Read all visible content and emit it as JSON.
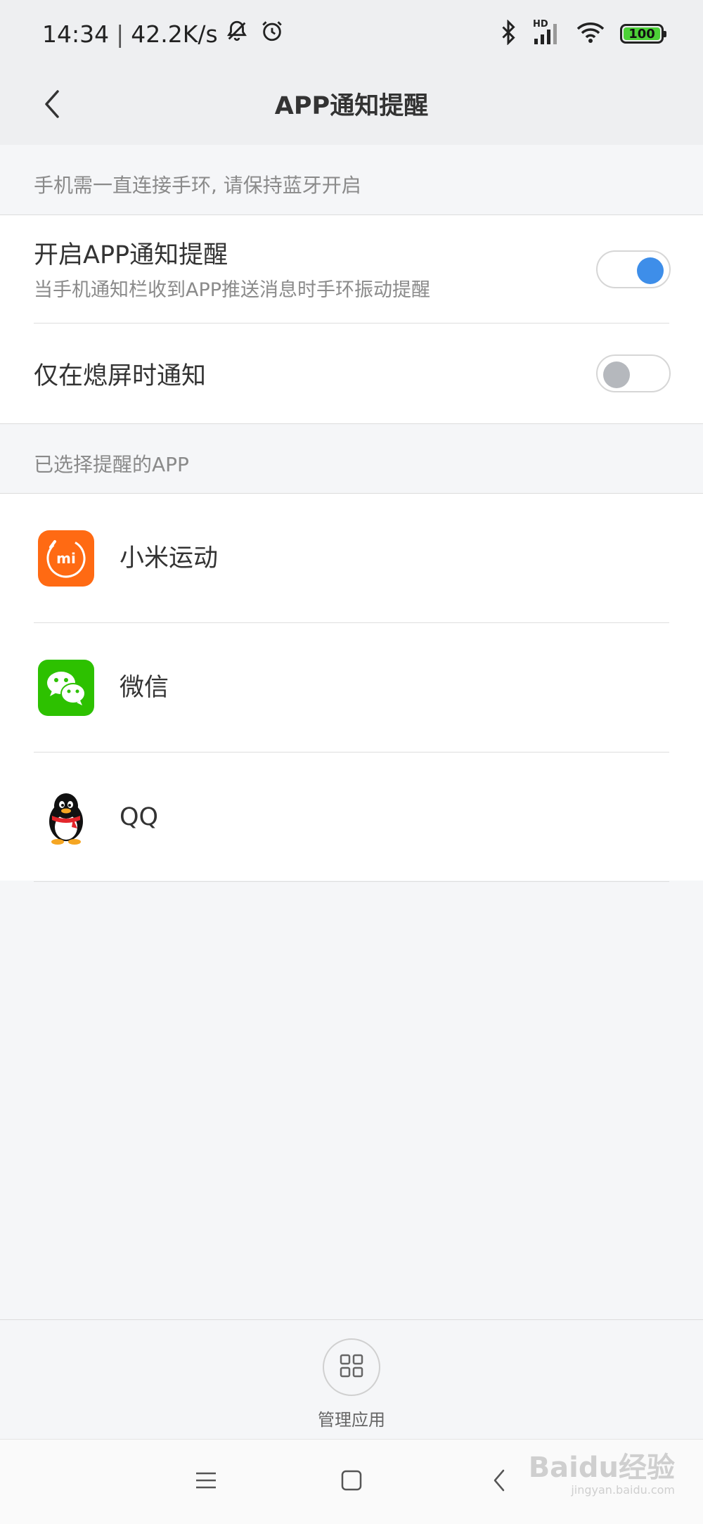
{
  "status_bar": {
    "time": "14:34",
    "separator": "|",
    "network_speed": "42.2K/s",
    "network_badge": "HD",
    "battery_level": "100",
    "icons": [
      "mute-bell-icon",
      "alarm-icon",
      "bluetooth-icon",
      "signal-icon",
      "wifi-icon",
      "battery-icon"
    ]
  },
  "header": {
    "title": "APP通知提醒",
    "back_icon": "chevron-left-icon"
  },
  "bluetooth_hint": "手机需一直连接手环, 请保持蓝牙开启",
  "settings": [
    {
      "title": "开启APP通知提醒",
      "subtitle": "当手机通知栏收到APP推送消息时手环振动提醒",
      "enabled": true
    },
    {
      "title": "仅在熄屏时通知",
      "enabled": false
    }
  ],
  "apps_section": {
    "header": "已选择提醒的APP",
    "apps": [
      {
        "name": "小米运动",
        "icon": "mi-fit-icon",
        "icon_text": "mi",
        "color": "#ff6a13"
      },
      {
        "name": "微信",
        "icon": "wechat-icon",
        "color": "#2dc100"
      },
      {
        "name": "QQ",
        "icon": "qq-penguin-icon"
      }
    ]
  },
  "manage_apps": {
    "label": "管理应用",
    "icon": "grid-icon"
  },
  "system_nav": {
    "icons": [
      "menu-icon",
      "home-icon",
      "back-icon"
    ]
  },
  "watermark": {
    "text": "Baidu经验",
    "sub": "jingyan.baidu.com"
  },
  "colors": {
    "toggle_on": "#3e8ee9",
    "toggle_off_knob": "#b5b8bd",
    "background": "#f5f6f8",
    "header_bg": "#eeeff1"
  }
}
